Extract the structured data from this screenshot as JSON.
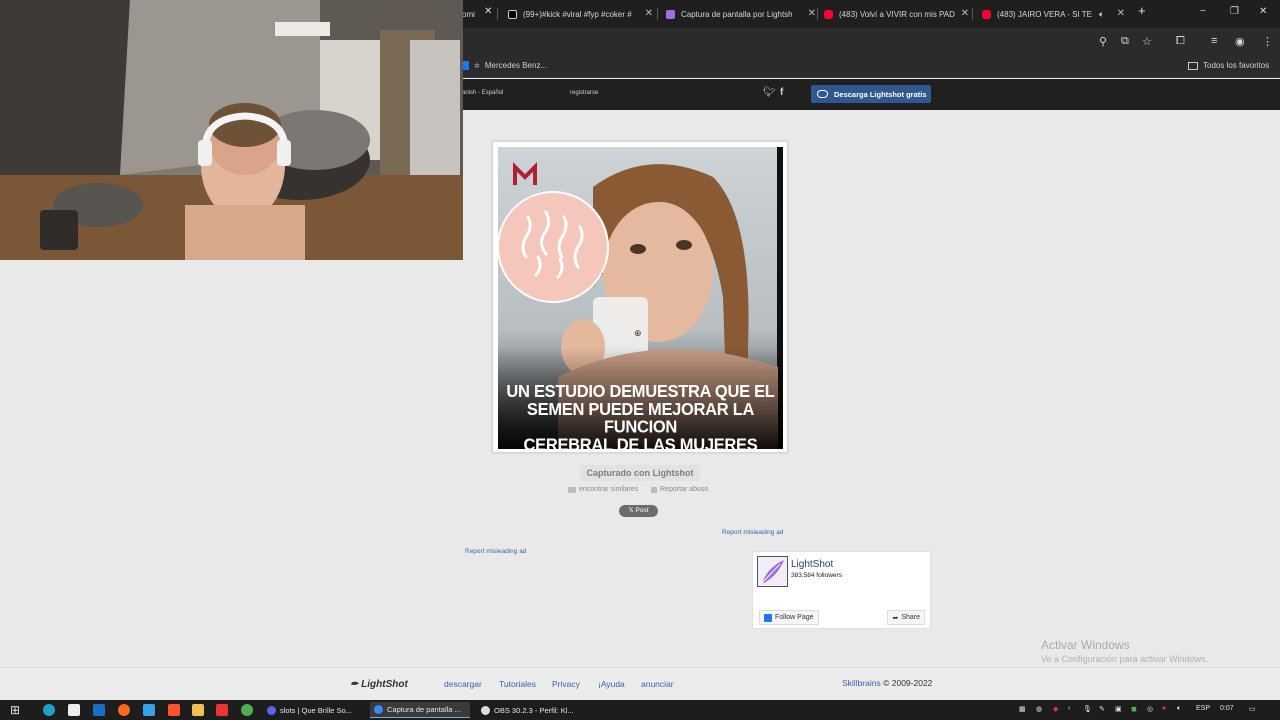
{
  "browser": {
    "tabs": [
      {
        "label": "(99+)#kick #viral #fyp #coker #",
        "icon": "tiktok-icon",
        "color": "#ffffff"
      },
      {
        "label": "Captura de pantalla por Lightsh",
        "icon": "lightshot-feather-icon",
        "color": "#a46be0"
      },
      {
        "label": "(483) Volví a VIVIR con mis PAD",
        "icon": "youtube-icon",
        "color": "#ff0033"
      },
      {
        "label": "(483) JAIRO VERA - SI TE V",
        "icon": "youtube-icon",
        "color": "#ff0033"
      }
    ],
    "partial_tab_label": "omi",
    "new_tab": "+",
    "window_controls": [
      "−",
      "❐",
      "✕"
    ],
    "bookmarks": [
      {
        "label": "Mercedes Benz...",
        "icon": "bookmark-icon"
      }
    ],
    "favorites_label": "Todos los favoritos"
  },
  "lightshot": {
    "language": "anish - Español",
    "register": "registrarse",
    "download_button": "Descarga Lightshot gratis",
    "image_text": [
      "UN ESTUDIO DEMUESTRA QUE EL",
      "SEMEN PUEDE MEJORAR LA FUNCION",
      "CEREBRAL DE LAS MUJERES"
    ],
    "captured_label": "Capturado con Lightshot",
    "find_similar": "encontrar similares",
    "report_abuse": "Reportar abuso",
    "post_button": "Post",
    "report_ad_right": "Report misleading ad",
    "report_ad_left": "Report misleading ad",
    "fb_widget": {
      "name": "LightShot",
      "followers": "383,584 followers",
      "follow_button": "Follow Page",
      "share_button": "Share"
    }
  },
  "windows_activation": {
    "title": "Activar Windows",
    "subtitle": "Ve a Configuración para activar Windows."
  },
  "footer": {
    "logo": "LightShot",
    "links": [
      "descargar",
      "Tutoriales",
      "Privacy",
      "¡Ayuda",
      "anunciar"
    ],
    "company": "Skillbrains",
    "copyright": "© 2009-2022"
  },
  "taskbar": {
    "apps": [
      {
        "label": "slots | Que Brille So...",
        "color": "#5865f2"
      },
      {
        "label": "Captura de pantalla ...",
        "color": "#4285f4"
      },
      {
        "label": "OBS 30.2.3 - Perfil: Kl...",
        "color": "#dddddd"
      }
    ],
    "language": "ESP",
    "time": "0:07"
  }
}
